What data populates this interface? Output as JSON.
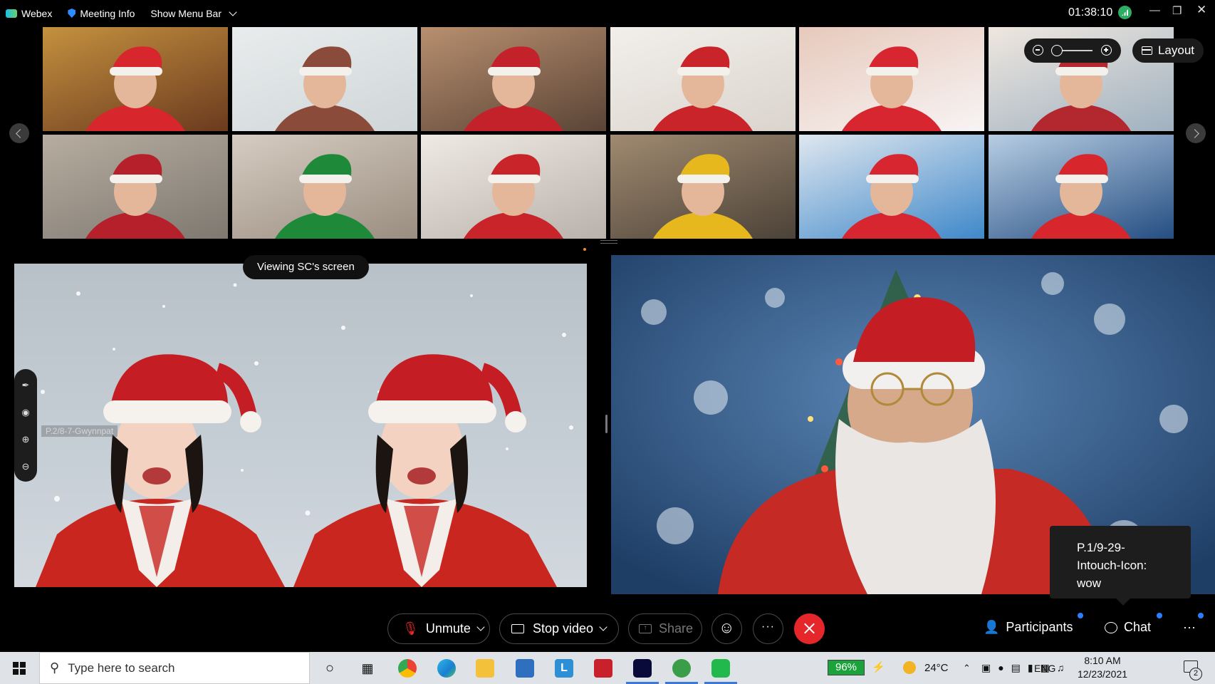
{
  "menubar": {
    "app_name": "Webex",
    "meeting_info": "Meeting Info",
    "show_menu_bar": "Show Menu Bar",
    "timer": "01:38:10"
  },
  "gallery": {
    "layout_label": "Layout",
    "tiles": [
      {
        "desc": "woman-santa-hat-fireplace",
        "c1": "#6b3a1e",
        "c2": "#c4913f",
        "accent": "#d7262c"
      },
      {
        "desc": "man-glasses-plaid-shirt",
        "c1": "#cfd6d8",
        "c2": "#e9eced",
        "accent": "#8a4b3a"
      },
      {
        "desc": "child-red-glasses-hat",
        "c1": "#5a4436",
        "c2": "#b88f6f",
        "accent": "#c3222b"
      },
      {
        "desc": "child-santa-hat-room",
        "c1": "#dad4cd",
        "c2": "#f2efea",
        "accent": "#c8242a"
      },
      {
        "desc": "child-merry-christmas-bg",
        "c1": "#f7f4f4",
        "c2": "#e7c9bc",
        "accent": "#d72630"
      },
      {
        "desc": "girl-reindeer-headband",
        "c1": "#9fb1c0",
        "c2": "#efe7df",
        "accent": "#b3282e"
      },
      {
        "desc": "boy-santa-hat-hand",
        "c1": "#7e7870",
        "c2": "#b7ada0",
        "accent": "#b5202b"
      },
      {
        "desc": "toddler-green-hat",
        "c1": "#9a8d80",
        "c2": "#d6ccc1",
        "accent": "#1e8a39"
      },
      {
        "desc": "child-blurred-santa-hat",
        "c1": "#b9b1aa",
        "c2": "#efeae4",
        "accent": "#c8242a"
      },
      {
        "desc": "boy-kitchen-yellow-shirt",
        "c1": "#4c4238",
        "c2": "#a08a70",
        "accent": "#e7b81e"
      },
      {
        "desc": "girl-mask-merry-christmas",
        "c1": "#3f88c9",
        "c2": "#dfe7ef",
        "accent": "#d72630"
      },
      {
        "desc": "santa-snow-village",
        "c1": "#254e82",
        "c2": "#b7cde3",
        "accent": "#d7262c"
      }
    ]
  },
  "share": {
    "viewing_label": "Viewing SC's screen",
    "participant_ghost": "P.2/8-7-Gwynnpat"
  },
  "speaker": {
    "tooltip": [
      "P.1/9-29-",
      "Intouch-Icon:",
      "wow"
    ]
  },
  "controls": {
    "unmute": "Unmute",
    "stop_video": "Stop video",
    "share": "Share",
    "participants": "Participants",
    "chat": "Chat"
  },
  "taskbar": {
    "search_placeholder": "Type here to search",
    "battery": "96%",
    "weather": "24°C",
    "lang": "ENG",
    "time": "8:10 AM",
    "date": "12/23/2021",
    "notifications": "2"
  },
  "colors": {
    "end_call": "#e5272c",
    "notify_dot": "#2b7fff",
    "accent_orange": "#f08a24"
  }
}
